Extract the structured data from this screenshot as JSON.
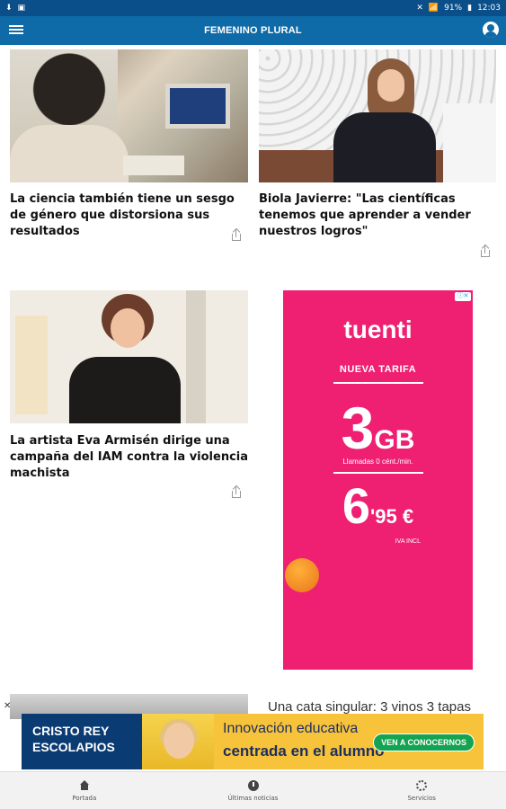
{
  "statusbar": {
    "time": "12:03",
    "battery": "91%"
  },
  "appbar": {
    "title": "FEMENINO PLURAL"
  },
  "articles": [
    {
      "headline": "La ciencia también tiene un sesgo de género que distorsiona sus resultados"
    },
    {
      "headline": "Biola Javierre: \"Las científicas tenemos que aprender a vender nuestros logros\""
    },
    {
      "headline": "La artista Eva Armisén dirige una campaña del IAM contra la violencia machista"
    }
  ],
  "ad_tuenti": {
    "brand": "tuenti",
    "tarifa": "NUEVA TARIFA",
    "gb": "3",
    "gb_unit": "GB",
    "llamadas": "Llamadas 0 cént./min.",
    "price_main": "6",
    "price_tail": "'95 €",
    "iva": "IVA INCL"
  },
  "partial_article": {
    "headline": "Una cata singular: 3 vinos 3 tapas"
  },
  "bottom_ad": {
    "brand": "CRISTO REY ESCOLAPIOS",
    "line1": "Innovación educativa",
    "line2": "centrada en el alumno",
    "cta": "VEN A CONOCERNOS"
  },
  "nav": {
    "items": [
      {
        "label": "Portada"
      },
      {
        "label": "Últimas noticias"
      },
      {
        "label": "Servicios"
      }
    ]
  }
}
